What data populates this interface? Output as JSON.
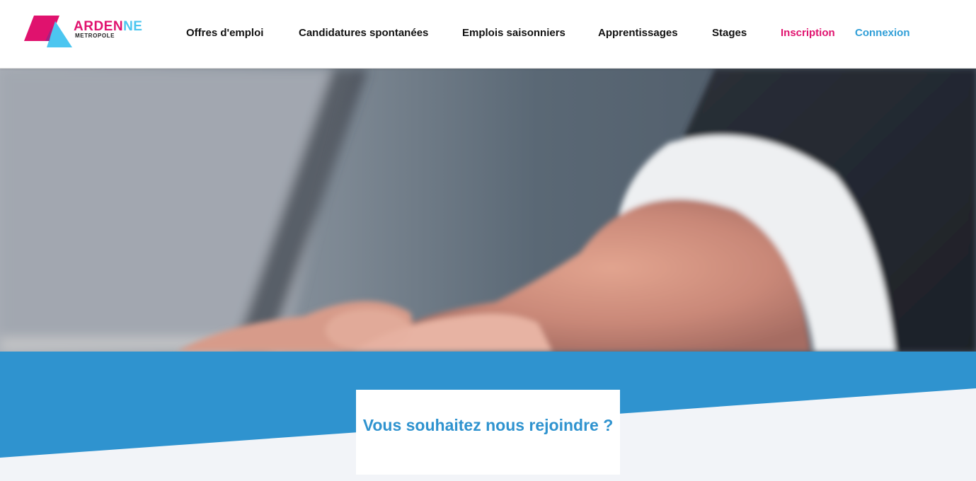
{
  "logo": {
    "brand_word_part1": "ARDEN",
    "brand_word_part2": "NE",
    "brand_sub": "METROPOLE",
    "colors": {
      "pink": "#e0126e",
      "cyan": "#4cc6f0"
    }
  },
  "nav": {
    "items": [
      {
        "label": "Offres d'emploi"
      },
      {
        "label": "Candidatures spontanées"
      },
      {
        "label": "Emplois saisonniers"
      },
      {
        "label": "Apprentissages"
      },
      {
        "label": "Stages"
      }
    ],
    "inscription": "Inscription",
    "connexion": "Connexion"
  },
  "hero": {
    "image": "handshake-photo"
  },
  "join": {
    "title": "Vous souhaitez nous rejoindre ?"
  },
  "colors": {
    "accent_blue": "#2f93cf",
    "pink": "#e0126e",
    "link_blue": "#2f9ed7",
    "light_bg": "#f2f4f8"
  }
}
